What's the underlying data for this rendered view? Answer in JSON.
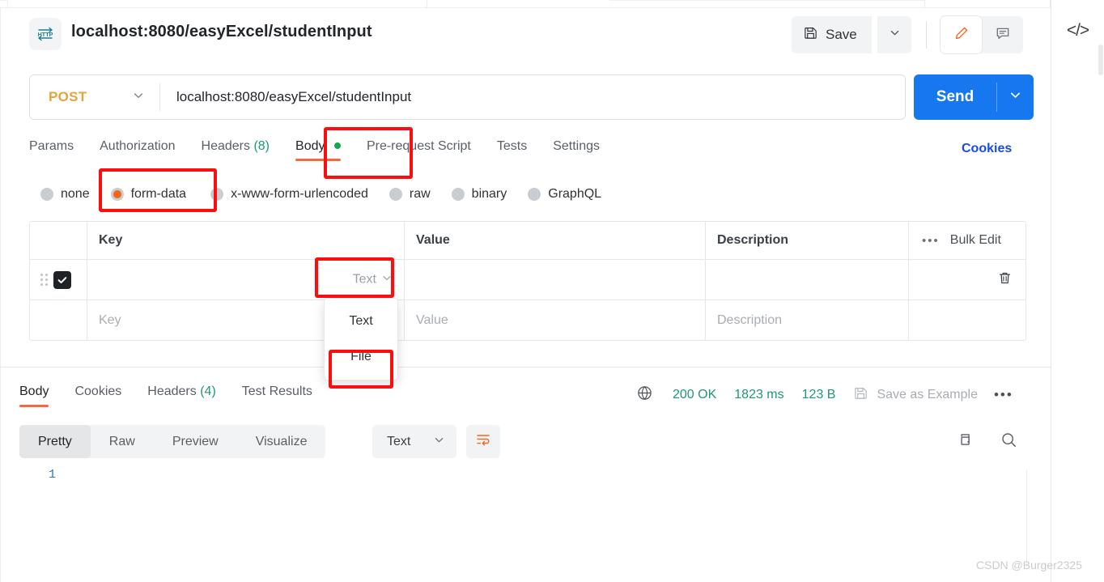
{
  "window": {
    "request_title": "localhost:8080/easyExcel/studentInput",
    "http_badge": "HTTP",
    "code_icon": "</>"
  },
  "toolbar": {
    "save_label": "Save",
    "save_icon": "floppy-disk-icon",
    "caret_icon": "chevron-down-icon",
    "edit_icon": "pencil-icon",
    "comment_icon": "comment-icon"
  },
  "url_bar": {
    "method": "POST",
    "url": "localhost:8080/easyExcel/studentInput",
    "send_label": "Send"
  },
  "request_tabs": {
    "items": [
      {
        "label": "Params",
        "count": "",
        "active": false
      },
      {
        "label": "Authorization",
        "count": "",
        "active": false
      },
      {
        "label": "Headers",
        "count": "(8)",
        "active": false
      },
      {
        "label": "Body",
        "count": "",
        "active": true,
        "dot": true
      },
      {
        "label": "Pre-request Script",
        "count": "",
        "active": false
      },
      {
        "label": "Tests",
        "count": "",
        "active": false
      },
      {
        "label": "Settings",
        "count": "",
        "active": false
      }
    ],
    "cookies_link": "Cookies"
  },
  "body_modes": {
    "items": [
      {
        "label": "none",
        "selected": false
      },
      {
        "label": "form-data",
        "selected": true
      },
      {
        "label": "x-www-form-urlencoded",
        "selected": false
      },
      {
        "label": "raw",
        "selected": false
      },
      {
        "label": "binary",
        "selected": false
      },
      {
        "label": "GraphQL",
        "selected": false
      }
    ]
  },
  "kv_table": {
    "headers": {
      "key": "Key",
      "value": "Value",
      "description": "Description",
      "bulk_edit": "Bulk Edit",
      "more": "•••"
    },
    "rows": [
      {
        "checked": true,
        "key": "",
        "type": "Text",
        "value": "",
        "description": "",
        "delete_icon": "trash-icon"
      }
    ],
    "placeholder_row": {
      "key": "Key",
      "value": "Value",
      "description": "Description"
    }
  },
  "type_dropdown": {
    "options": [
      {
        "label": "Text",
        "highlighted": false
      },
      {
        "label": "File",
        "highlighted": true
      }
    ]
  },
  "response": {
    "tabs": [
      {
        "label": "Body",
        "count": "",
        "active": true
      },
      {
        "label": "Cookies",
        "count": "",
        "active": false
      },
      {
        "label": "Headers",
        "count": "(4)",
        "active": false
      },
      {
        "label": "Test Results",
        "count": "",
        "active": false
      }
    ],
    "status_icon": "globe-icon",
    "status_code": "200 OK",
    "time": "1823 ms",
    "size": "123 B",
    "save_example": "Save as Example",
    "more": "•••",
    "viewer_tabs": [
      {
        "label": "Pretty",
        "active": true
      },
      {
        "label": "Raw",
        "active": false
      },
      {
        "label": "Preview",
        "active": false
      },
      {
        "label": "Visualize",
        "active": false
      }
    ],
    "language": "Text",
    "wrap_icon": "word-wrap-icon",
    "copy_icon": "copy-icon",
    "search_icon": "search-icon",
    "line_numbers": [
      "1"
    ],
    "body_content": ""
  },
  "watermark": "CSDN @Burger2325",
  "colors": {
    "accent_orange": "#f26b3a",
    "send_blue": "#1677ee",
    "method_orange": "#e8a33d",
    "status_green": "#1d9a6c",
    "annotation_red": "#fd0d0d",
    "link_blue": "#1a4ce0"
  }
}
